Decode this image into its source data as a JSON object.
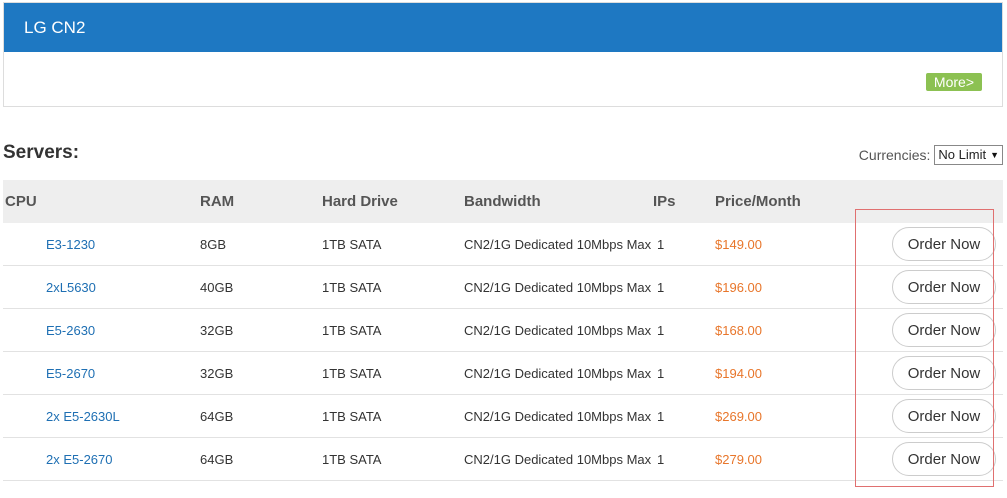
{
  "panel": {
    "title": "LG CN2",
    "more_label": "More>"
  },
  "servers_title": "Servers:",
  "currencies": {
    "label": "Currencies:",
    "selected": "No Limit"
  },
  "table": {
    "headers": [
      "CPU",
      "RAM",
      "Hard Drive",
      "Bandwidth",
      "IPs",
      "Price/Month"
    ],
    "rows": [
      {
        "cpu": "E3-1230",
        "ram": "8GB",
        "hdd": "1TB SATA",
        "bandwidth": "CN2/1G Dedicated 10Mbps Max",
        "ips": "1",
        "price": "$149.00",
        "order": "Order Now"
      },
      {
        "cpu": "2xL5630",
        "ram": "40GB",
        "hdd": "1TB SATA",
        "bandwidth": "CN2/1G Dedicated 10Mbps Max",
        "ips": "1",
        "price": "$196.00",
        "order": "Order Now"
      },
      {
        "cpu": "E5-2630",
        "ram": "32GB",
        "hdd": "1TB SATA",
        "bandwidth": "CN2/1G Dedicated 10Mbps Max",
        "ips": "1",
        "price": "$168.00",
        "order": "Order Now"
      },
      {
        "cpu": "E5-2670",
        "ram": "32GB",
        "hdd": "1TB SATA",
        "bandwidth": "CN2/1G Dedicated 10Mbps Max",
        "ips": "1",
        "price": "$194.00",
        "order": "Order Now"
      },
      {
        "cpu": "2x E5-2630L",
        "ram": "64GB",
        "hdd": "1TB SATA",
        "bandwidth": "CN2/1G Dedicated 10Mbps Max",
        "ips": "1",
        "price": "$269.00",
        "order": "Order Now"
      },
      {
        "cpu": "2x E5-2670",
        "ram": "64GB",
        "hdd": "1TB SATA",
        "bandwidth": "CN2/1G Dedicated 10Mbps Max",
        "ips": "1",
        "price": "$279.00",
        "order": "Order Now"
      }
    ]
  },
  "colors": {
    "header_blue": "#1e78c2",
    "more_green": "#8cc152",
    "link_blue": "#1e6fb3",
    "price_orange": "#e8762b",
    "highlight_red": "#e07070"
  },
  "icons": {
    "select_caret": "caret-down-icon"
  }
}
